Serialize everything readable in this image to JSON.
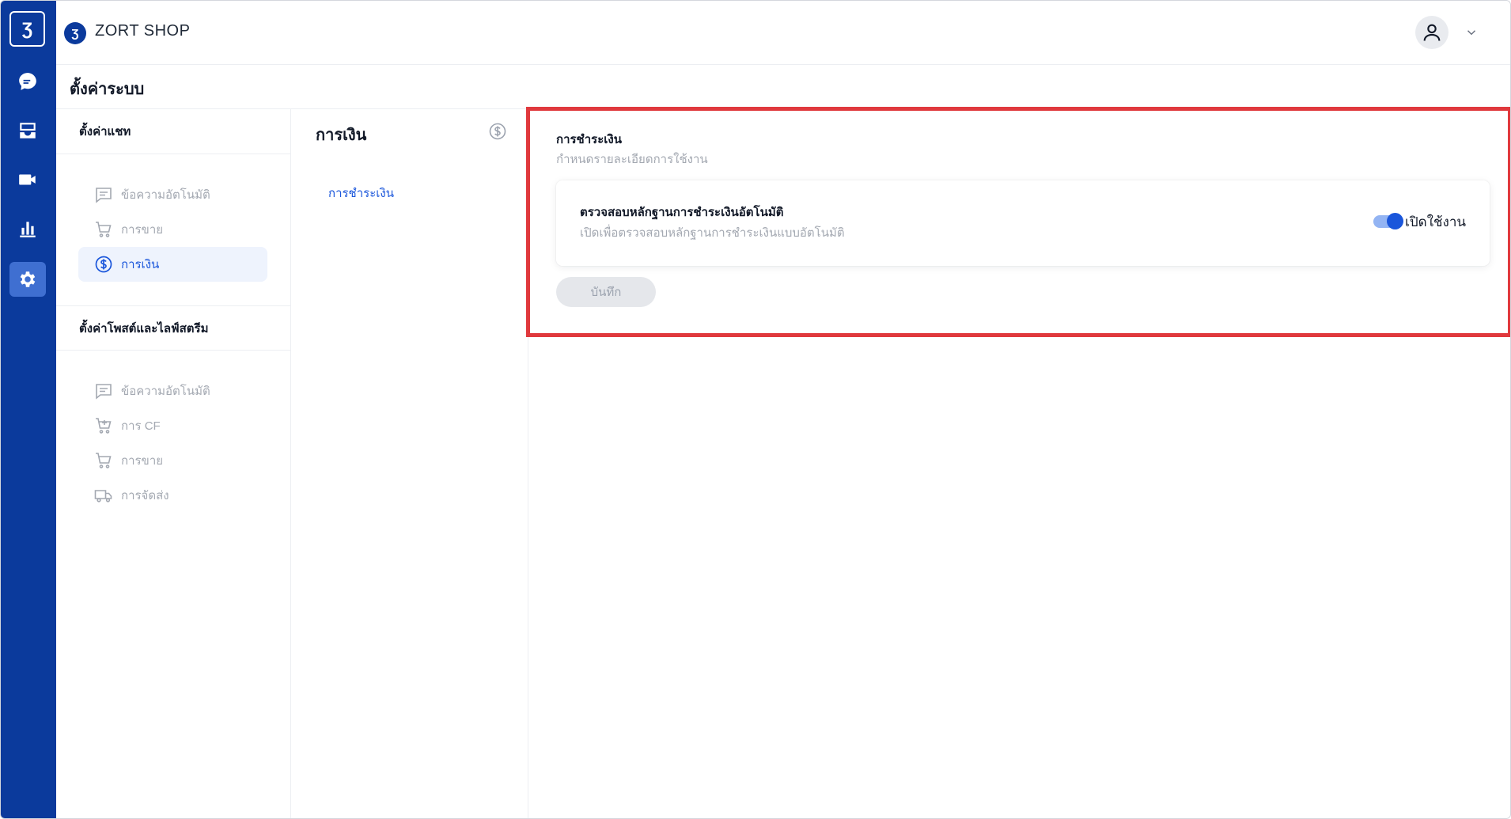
{
  "rail": {
    "logo_glyph": "Ʒ",
    "items": [
      {
        "icon": "chat-icon"
      },
      {
        "icon": "inbox-icon"
      },
      {
        "icon": "video-icon"
      },
      {
        "icon": "bar-chart-icon"
      },
      {
        "icon": "gear-icon",
        "active": true
      }
    ]
  },
  "header": {
    "brand_glyph": "Ʒ",
    "brand_name": "ZORT SHOP"
  },
  "page": {
    "title": "ตั้งค่าระบบ"
  },
  "sidebar": {
    "chat_section_title": "ตั้งค่าแชท",
    "chat_items": [
      {
        "label": "ข้อความอัตโนมัติ",
        "icon": "message-icon"
      },
      {
        "label": "การขาย",
        "icon": "cart-icon"
      },
      {
        "label": "การเงิน",
        "icon": "dollar-icon",
        "active": true
      }
    ],
    "post_section_title": "ตั้งค่าโพสต์และไลฟ์สตรีม",
    "post_items": [
      {
        "label": "ข้อความอัตโนมัติ",
        "icon": "message-icon"
      },
      {
        "label": "การ CF",
        "icon": "cart-plus-icon"
      },
      {
        "label": "การขาย",
        "icon": "cart-icon"
      },
      {
        "label": "การจัดส่ง",
        "icon": "truck-icon"
      }
    ]
  },
  "submenu": {
    "title": "การเงิน",
    "link": "การชำระเงิน"
  },
  "panel": {
    "title": "การชำระเงิน",
    "subtitle": "กำหนดรายละเอียดการใช้งาน",
    "card_title": "ตรวจสอบหลักฐานการชำระเงินอัตโนมัติ",
    "card_subtitle": "เปิดเพื่อตรวจสอบหลักฐานการชำระเงินแบบอัตโนมัติ",
    "toggle_label": "เปิดใช้งาน",
    "toggle_on": true,
    "save_label": "บันทึก"
  },
  "colors": {
    "rail": "#0b3a9c",
    "accent": "#1a56db",
    "highlight_border": "#e0393d"
  }
}
